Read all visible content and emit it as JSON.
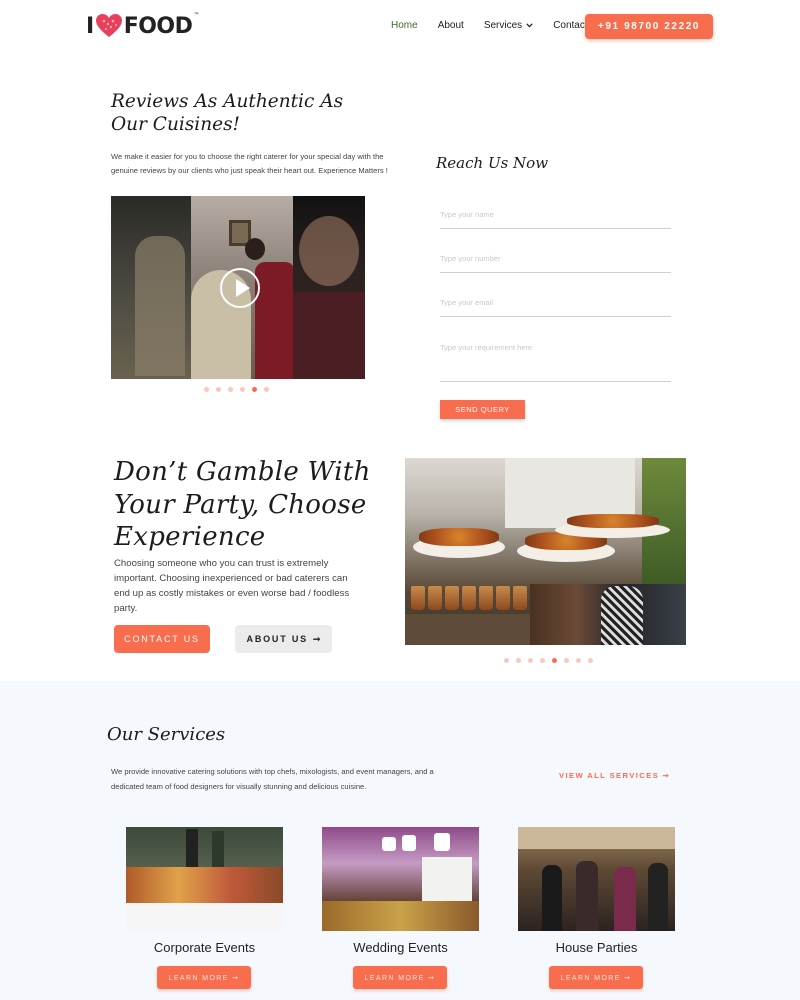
{
  "nav": {
    "logo_i": "I",
    "logo_food": "FOOD",
    "logo_tm": "™",
    "links": [
      "Home",
      "About",
      "Services",
      "Contact"
    ],
    "phone": "+91 98700 22220",
    "active_color": "#3d6b2e"
  },
  "reviews": {
    "title": "Reviews As Authentic As Our Cuisines!",
    "description": "We make it easier for you to choose the right caterer for your special day with the genuine reviews by our clients who just speak their heart out. Experience Matters !",
    "carousel_active_index": 4,
    "carousel_count": 6
  },
  "reach": {
    "title": "Reach Us Now",
    "placeholders": [
      "Type your name",
      "Type your number",
      "Type your email",
      "Type your requirement here"
    ],
    "send_label": "SEND QUERY"
  },
  "gamble": {
    "title": "Don’t Gamble With Your Party, Choose Experience",
    "description": "Choosing someone who you can trust is extremely important. Choosing inexperienced or bad caterers can end up as costly mistakes or even worse bad / foodless party.",
    "contact_label": "CONTACT US",
    "about_label": "ABOUT US",
    "about_arrow": "➞",
    "carousel_active_index": 4,
    "carousel_count": 8
  },
  "services": {
    "title": "Our Services",
    "description": "We provide innovative catering solutions with top chefs, mixologists, and event managers, and a dedicated team of food designers for visually stunning and delicious cuisine.",
    "view_all": "VIEW ALL SERVICES ➞",
    "cards": [
      {
        "name": "Corporate Events",
        "button": "LEARN MORE ➞"
      },
      {
        "name": "Wedding Events",
        "button": "LEARN MORE ➞"
      },
      {
        "name": "House Parties",
        "button": "LEARN MORE ➞"
      }
    ]
  },
  "colors": {
    "accent": "#f96d4f",
    "dot_inactive": "#f8c8bd",
    "services_bg": "#f5f8fd"
  }
}
